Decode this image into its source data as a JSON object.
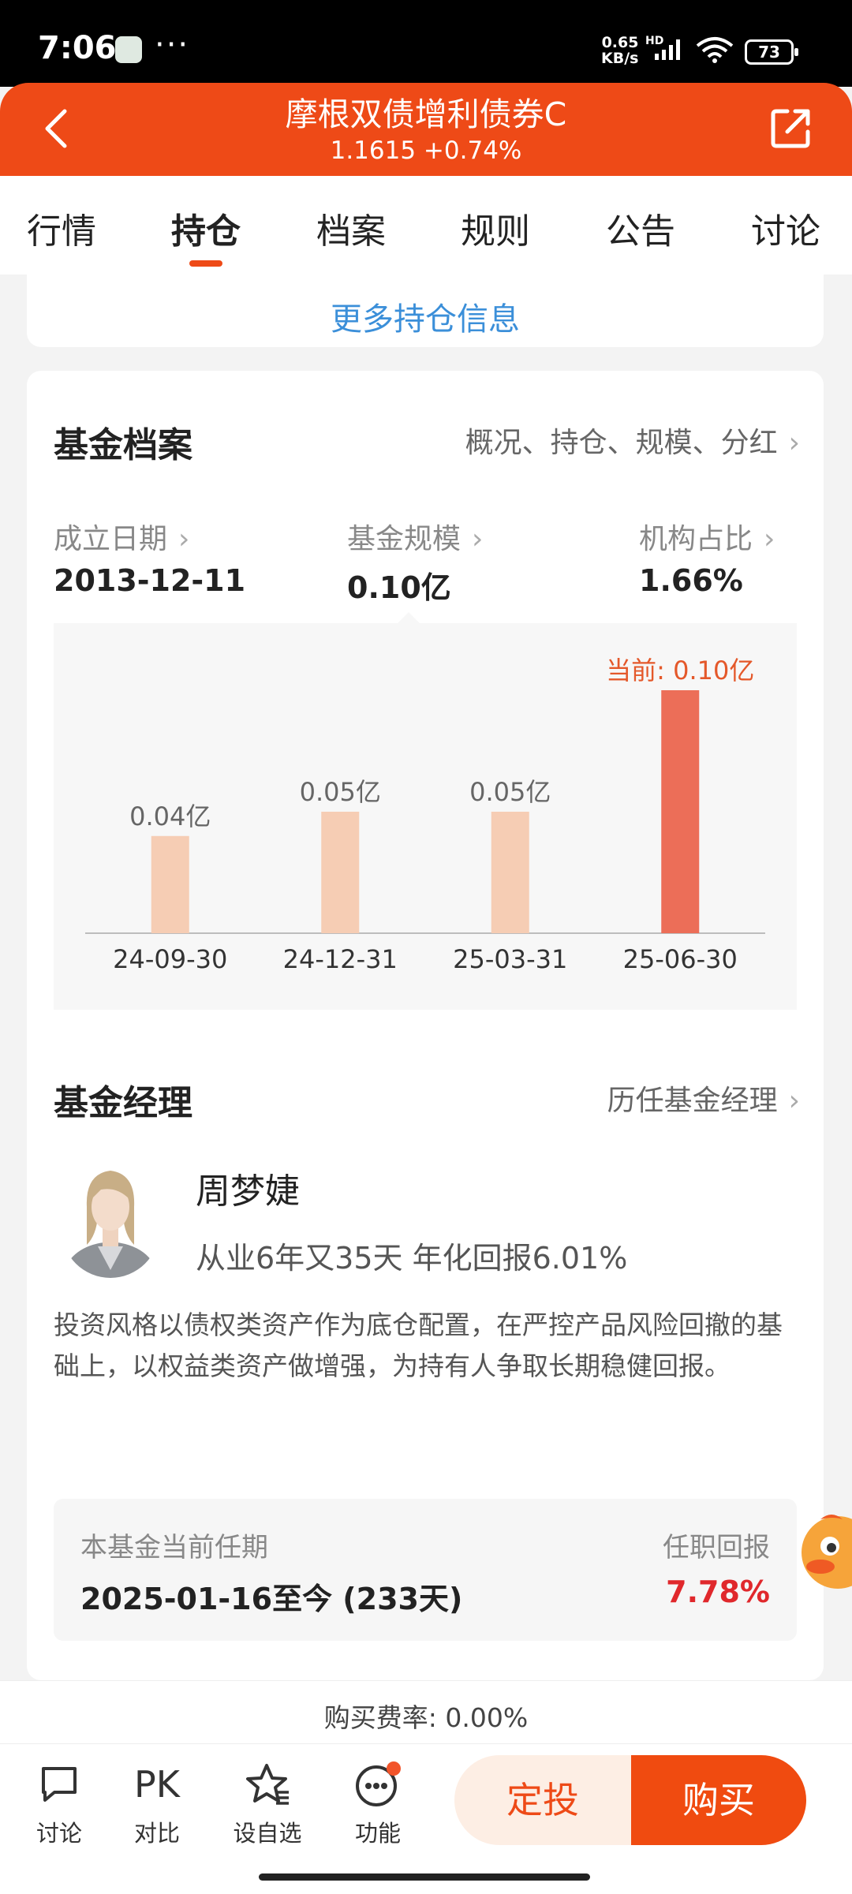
{
  "status": {
    "time": "7:06",
    "net_speed": "0.65",
    "net_unit": "KB/s",
    "hd": "HD",
    "battery": "73"
  },
  "header": {
    "title": "摩根双债增利债券C",
    "subtitle": "1.1615 +0.74%"
  },
  "tabs": [
    "行情",
    "持仓",
    "档案",
    "规则",
    "公告",
    "讨论"
  ],
  "active_tab": "持仓",
  "holdings": {
    "more_label": "更多持仓信息"
  },
  "fund_profile": {
    "title": "基金档案",
    "link": "概况、持仓、规模、分红",
    "stats": [
      {
        "label": "成立日期",
        "value": "2013-12-11"
      },
      {
        "label": "基金规模",
        "value": "0.10亿"
      },
      {
        "label": "机构占比",
        "value": "1.66%"
      }
    ]
  },
  "chart_data": {
    "type": "bar",
    "categories": [
      "24-09-30",
      "24-12-31",
      "25-03-31",
      "25-06-30"
    ],
    "values": [
      0.04,
      0.05,
      0.05,
      0.1
    ],
    "data_labels": [
      "0.04亿",
      "0.05亿",
      "0.05亿",
      "当前: 0.10亿"
    ],
    "unit": "亿",
    "colors": [
      "#f6cdb4",
      "#f6cdb4",
      "#f6cdb4",
      "#ec6e58"
    ],
    "label_colors": [
      "#666666",
      "#666666",
      "#666666",
      "#e4582a"
    ]
  },
  "manager": {
    "title": "基金经理",
    "link": "历任基金经理",
    "name": "周梦婕",
    "meta": "从业6年又35天 年化回报6.01%",
    "description": "投资风格以债权类资产作为底仓配置，在严控产品风险回撤的基础上，以权益类资产做增强，为持有人争取长期稳健回报。",
    "tenure_label": "本基金当前任期",
    "tenure_value": "2025-01-16至今 (233天)",
    "return_label": "任职回报",
    "return_value": "7.78%"
  },
  "fee": {
    "text": "购买费率: 0.00%"
  },
  "bottom_bar": {
    "discuss": "讨论",
    "compare_icon": "PK",
    "compare": "对比",
    "watchlist": "设自选",
    "functions": "功能",
    "dingtou": "定投",
    "buy": "购买"
  },
  "colors": {
    "brand": "#ee4a17",
    "link": "#3b8fd9",
    "positive": "#e0282c"
  }
}
